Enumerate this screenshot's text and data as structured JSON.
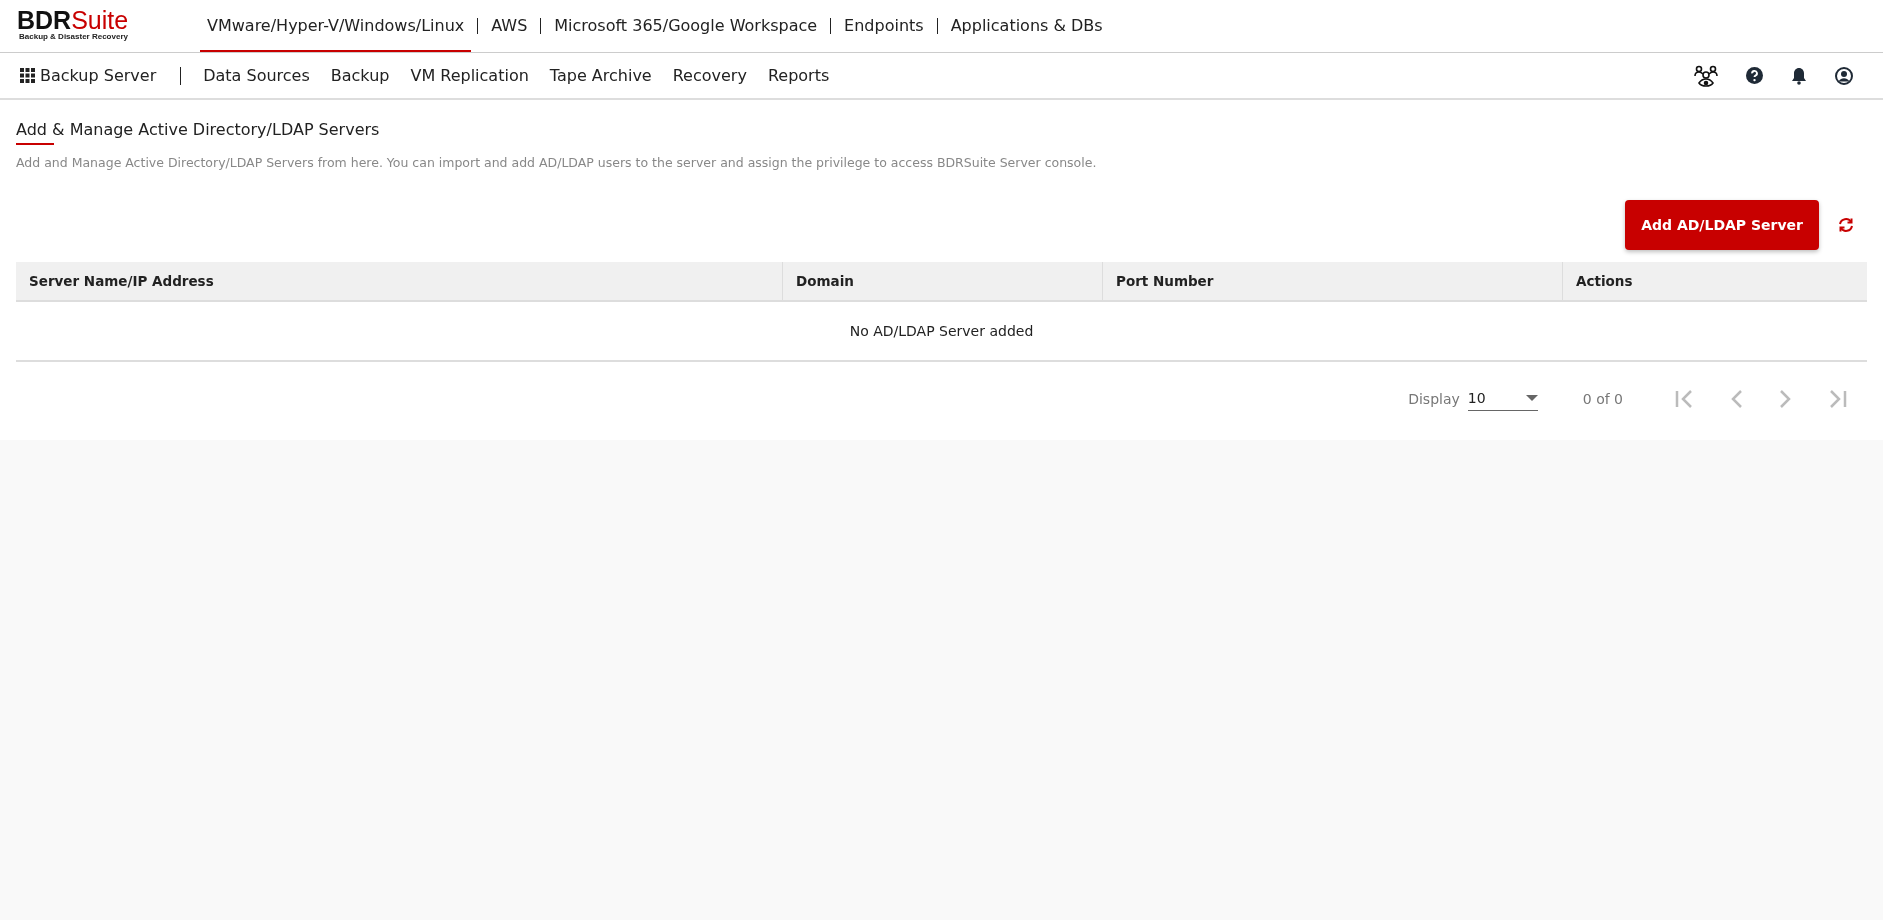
{
  "logo": {
    "brand": "BDR",
    "brand_accent": "Suite",
    "tagline": "Backup & Disaster Recovery"
  },
  "product_tabs": [
    {
      "label": "VMware/Hyper-V/Windows/Linux",
      "selected": true
    },
    {
      "label": "AWS",
      "selected": false
    },
    {
      "label": "Microsoft 365/Google Workspace",
      "selected": false
    },
    {
      "label": "Endpoints",
      "selected": false
    },
    {
      "label": "Applications & DBs",
      "selected": false
    }
  ],
  "server_menu": {
    "label": "Backup Server"
  },
  "nav_items": [
    "Data Sources",
    "Backup",
    "VM Replication",
    "Tape Archive",
    "Recovery",
    "Reports"
  ],
  "page": {
    "title": "Add & Manage Active Directory/LDAP Servers",
    "description": "Add and Manage Active Directory/LDAP Servers from here. You can import and add AD/LDAP users to the server and assign the privilege to access BDRSuite Server console.",
    "add_button": "Add AD/LDAP Server"
  },
  "table": {
    "columns": [
      "Server Name/IP Address",
      "Domain",
      "Port Number",
      "Actions"
    ],
    "empty_message": "No AD/LDAP Server added"
  },
  "pagination": {
    "display_label": "Display",
    "page_size": "10",
    "range": "0 of 0"
  }
}
